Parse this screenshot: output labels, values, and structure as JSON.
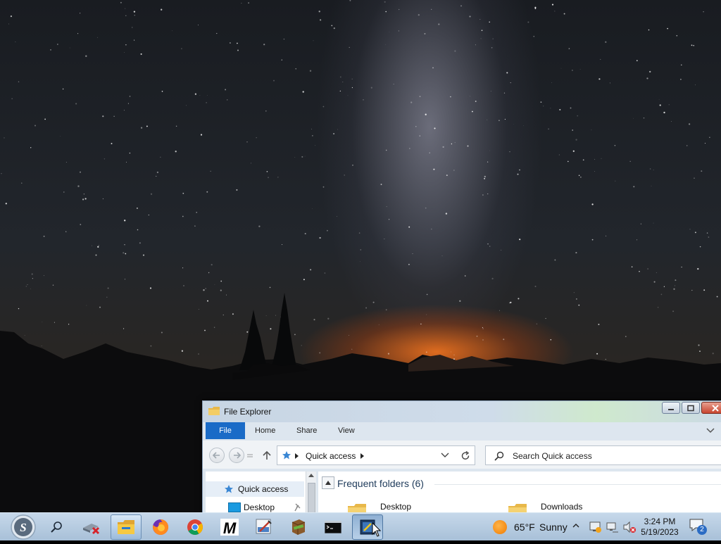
{
  "explorer": {
    "title": "File Explorer",
    "ribbon_tabs": [
      "File",
      "Home",
      "Share",
      "View"
    ],
    "address": "Quick access",
    "search_placeholder": "Search Quick access",
    "nav_pane": {
      "quick_access": "Quick access",
      "desktop": "Desktop"
    },
    "section_title": "Frequent folders (6)",
    "folders": [
      "Desktop",
      "Downloads"
    ]
  },
  "taskbar": {
    "apps": [
      "start",
      "search",
      "disconnect-tool",
      "file-explorer",
      "firefox",
      "chrome",
      "m-app",
      "image-editor",
      "winrar",
      "terminal",
      "screen-tool"
    ],
    "weather": {
      "temp": "65°F",
      "condition": "Sunny",
      "icon": "sun-icon"
    },
    "time": "3:24 PM",
    "date": "5/19/2023",
    "notification_count": "2"
  },
  "colors": {
    "ribbon_file": "#1a6bc7",
    "taskbar": "#b8cde2",
    "sky_glow": "#f07a1e"
  }
}
